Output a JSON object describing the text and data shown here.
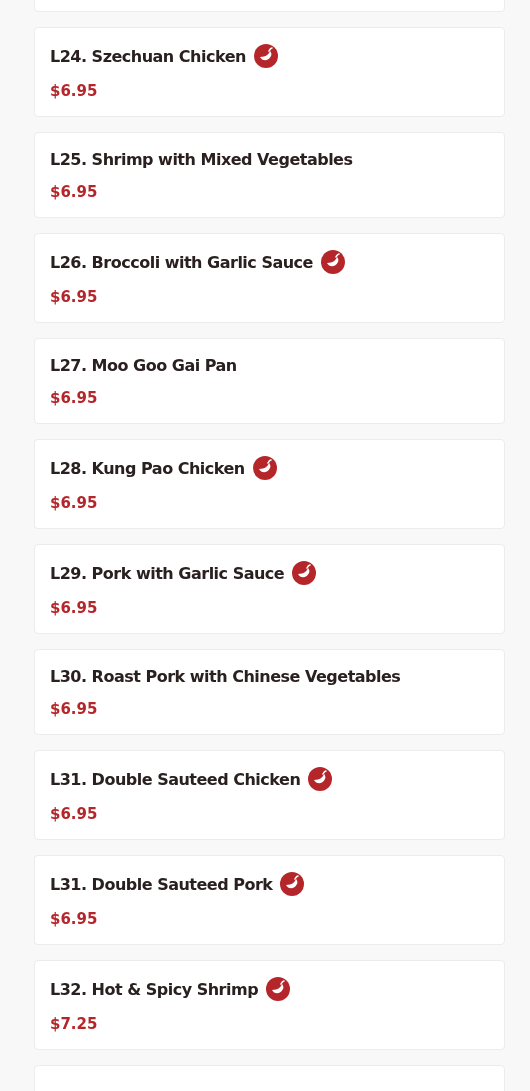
{
  "menu_items": [
    {
      "kind": "cut"
    },
    {
      "kind": "dish",
      "name": "L24. Szechuan Chicken",
      "spicy": true,
      "price": "$6.95"
    },
    {
      "kind": "dish",
      "name": "L25. Shrimp with Mixed Vegetables",
      "spicy": false,
      "price": "$6.95"
    },
    {
      "kind": "dish",
      "name": "L26. Broccoli with Garlic Sauce",
      "spicy": true,
      "price": "$6.95"
    },
    {
      "kind": "dish",
      "name": "L27. Moo Goo Gai Pan",
      "spicy": false,
      "price": "$6.95"
    },
    {
      "kind": "dish",
      "name": "L28. Kung Pao Chicken",
      "spicy": true,
      "price": "$6.95"
    },
    {
      "kind": "dish",
      "name": "L29. Pork with Garlic Sauce",
      "spicy": true,
      "price": "$6.95"
    },
    {
      "kind": "dish",
      "name": "L30. Roast Pork with Chinese Vegetables",
      "spicy": false,
      "price": "$6.95"
    },
    {
      "kind": "dish",
      "name": "L31. Double Sauteed Chicken",
      "spicy": true,
      "price": "$6.95"
    },
    {
      "kind": "dish",
      "name": "L31. Double Sauteed Pork",
      "spicy": true,
      "price": "$6.95"
    },
    {
      "kind": "dish",
      "name": "L32. Hot & Spicy Shrimp",
      "spicy": true,
      "price": "$7.25"
    },
    {
      "kind": "cut"
    }
  ]
}
